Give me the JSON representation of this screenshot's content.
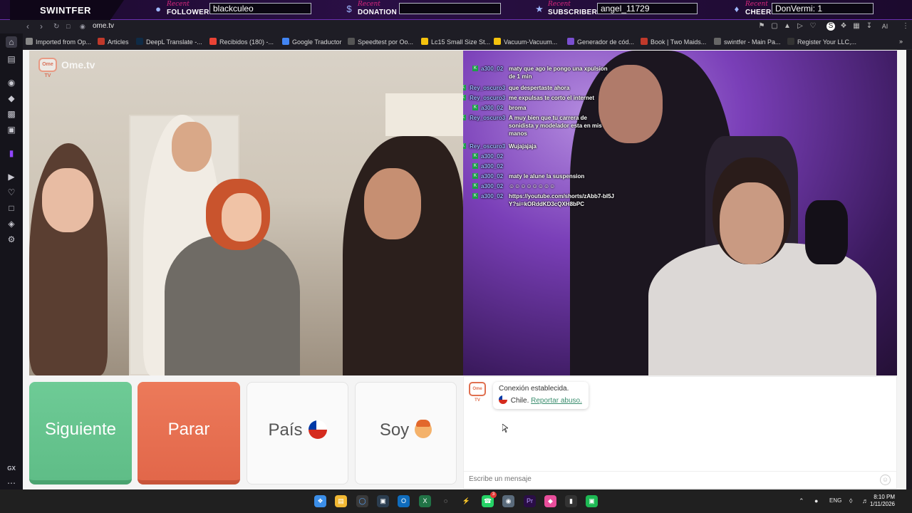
{
  "overlay": {
    "brand": "SWINTFER",
    "recent_word": "Recent",
    "items": [
      {
        "label": "FOLLOWER",
        "value": "blackculeo",
        "icon": "person-icon"
      },
      {
        "label": "DONATION",
        "value": "",
        "icon": "dollar-icon"
      },
      {
        "label": "SUBSCRIBER",
        "value": "angel_11729",
        "icon": "star-icon"
      },
      {
        "label": "CHEER",
        "value": "DonVermi: 1",
        "icon": "drop-icon"
      }
    ]
  },
  "browser": {
    "url": "ome.tv",
    "bookmarks": [
      {
        "label": "Imported from Op...",
        "color": "#888888"
      },
      {
        "label": "Articles",
        "color": "#c0392b"
      },
      {
        "label": "DeepL Translate -...",
        "color": "#0f2b46"
      },
      {
        "label": "Recibidos (180) -...",
        "color": "#ea4335"
      },
      {
        "label": "Google Traductor",
        "color": "#4285f4"
      },
      {
        "label": "Speedtest por Oo...",
        "color": "#222222"
      },
      {
        "label": "Lc15 Small Size St...",
        "color": "#f4c20d"
      },
      {
        "label": "Vacuum-Vacuum...",
        "color": "#f4c20d"
      },
      {
        "label": "Generador de cód...",
        "color": "#7a4fd0"
      },
      {
        "label": "Book | Two Maids...",
        "color": "#c0392b"
      },
      {
        "label": "swintfer - Main Pa...",
        "color": "#666666"
      },
      {
        "label": "Register Your LLC,...",
        "color": "#333333"
      }
    ],
    "ai_label": "AI",
    "gx_label": "GX"
  },
  "ometv": {
    "logo_text": "Ome.tv",
    "logo_badge": "Ome TV",
    "buttons": {
      "next": "Siguiente",
      "stop": "Parar",
      "country": "País",
      "gender": "Soy"
    },
    "system_message": {
      "line1": "Conexión establecida.",
      "country": "Chile.",
      "report": "Reportar abuso."
    },
    "input_placeholder": "Escribe un mensaje"
  },
  "stream_chat": [
    {
      "user": "a300_02",
      "text": "maty que ago le pongo una xpulsion de 1 min"
    },
    {
      "user": "Rey_oscuro3",
      "text": "que despertaste ahora"
    },
    {
      "user": "Rey_oscuro3",
      "text": "me expulsas te corto el internet"
    },
    {
      "user": "a300_02",
      "text": "broma"
    },
    {
      "user": "Rey_oscuro3",
      "text": "A muy bien que tu carrera de sonidista y modelador esta en mis manos"
    },
    {
      "user": "Rey_oscuro3",
      "text": "Wujajajaja"
    },
    {
      "user": "a300_02",
      "text": ""
    },
    {
      "user": "a300_02",
      "text": ""
    },
    {
      "user": "a300_02",
      "text": "maty le alune la suspension"
    },
    {
      "user": "a300_02",
      "text": ""
    },
    {
      "user": "a300_02",
      "text": "https://youtube.com/shorts/zAbb7-bI5JY?si=kORddKD3cQXH8bPC"
    }
  ],
  "taskbar": {
    "lang": "ENG",
    "time": "8:10 PM",
    "date": "1/11/2026",
    "whatsapp_badge": "3"
  }
}
